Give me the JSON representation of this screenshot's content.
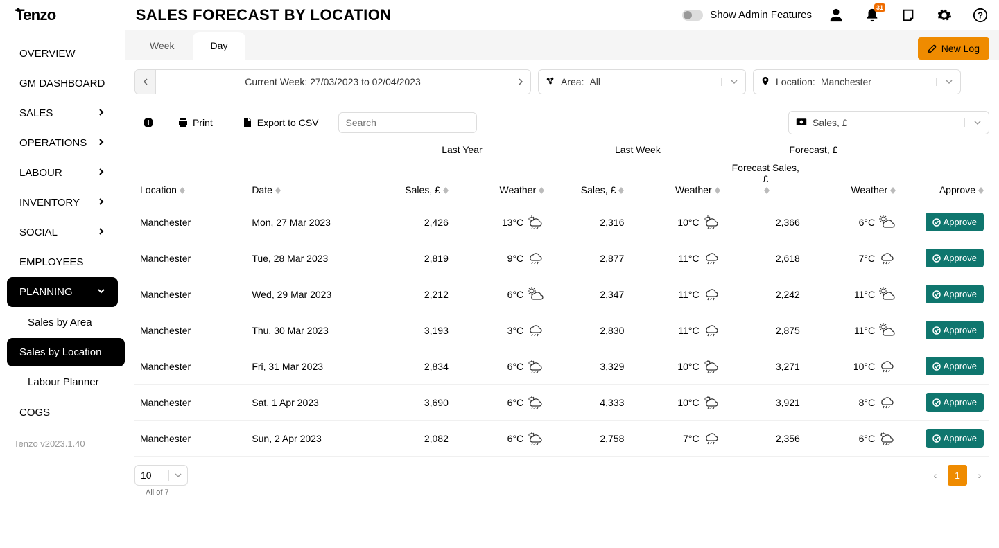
{
  "header": {
    "logo_text": "Tenzo",
    "page_title": "SALES FORECAST BY LOCATION",
    "admin_toggle_label": "Show Admin Features",
    "notification_count": "31",
    "new_log_label": "New Log"
  },
  "sidebar": {
    "items": [
      {
        "label": "OVERVIEW",
        "has_children": false
      },
      {
        "label": "GM DASHBOARD",
        "has_children": false
      },
      {
        "label": "SALES",
        "has_children": true
      },
      {
        "label": "OPERATIONS",
        "has_children": true
      },
      {
        "label": "LABOUR",
        "has_children": true
      },
      {
        "label": "INVENTORY",
        "has_children": true
      },
      {
        "label": "SOCIAL",
        "has_children": true
      },
      {
        "label": "EMPLOYEES",
        "has_children": false
      },
      {
        "label": "PLANNING",
        "has_children": true,
        "expanded": true,
        "active": true
      }
    ],
    "planning_subs": [
      {
        "label": "Sales by Area"
      },
      {
        "label": "Sales by Location",
        "active": true
      },
      {
        "label": "Labour Planner"
      }
    ],
    "cogs_label": "COGS",
    "version": "Tenzo v2023.1.40"
  },
  "tabs": {
    "week": "Week",
    "day": "Day"
  },
  "filters": {
    "date_label": "Current Week: 27/03/2023 to 02/04/2023",
    "area_label": "Area:",
    "area_value": "All",
    "location_label": "Location:",
    "location_value": "Manchester"
  },
  "toolbar": {
    "print_label": "Print",
    "export_label": "Export to CSV",
    "search_placeholder": "Search",
    "metric_value": "Sales, £"
  },
  "table": {
    "group_headers": {
      "last_year": "Last Year",
      "last_week": "Last Week",
      "forecast": "Forecast, £"
    },
    "columns": {
      "location": "Location",
      "date": "Date",
      "sales": "Sales, £",
      "weather": "Weather",
      "forecast_sales": "Forecast Sales, £",
      "approve": "Approve"
    },
    "approve_btn_label": "Approve",
    "rows": [
      {
        "location": "Manchester",
        "date": "Mon, 27 Mar 2023",
        "ly_sales": "2,426",
        "ly_temp": "13°C",
        "ly_wicon": "sleet",
        "lw_sales": "2,316",
        "lw_temp": "10°C",
        "lw_wicon": "sleet",
        "fc_sales": "2,366",
        "fc_temp": "6°C",
        "fc_wicon": "partly"
      },
      {
        "location": "Manchester",
        "date": "Tue, 28 Mar 2023",
        "ly_sales": "2,819",
        "ly_temp": "9°C",
        "ly_wicon": "rain",
        "lw_sales": "2,877",
        "lw_temp": "11°C",
        "lw_wicon": "rain",
        "fc_sales": "2,618",
        "fc_temp": "7°C",
        "fc_wicon": "rain"
      },
      {
        "location": "Manchester",
        "date": "Wed, 29 Mar 2023",
        "ly_sales": "2,212",
        "ly_temp": "6°C",
        "ly_wicon": "partly",
        "lw_sales": "2,347",
        "lw_temp": "11°C",
        "lw_wicon": "rain",
        "fc_sales": "2,242",
        "fc_temp": "11°C",
        "fc_wicon": "partly"
      },
      {
        "location": "Manchester",
        "date": "Thu, 30 Mar 2023",
        "ly_sales": "3,193",
        "ly_temp": "3°C",
        "ly_wicon": "rain",
        "lw_sales": "2,830",
        "lw_temp": "11°C",
        "lw_wicon": "rain",
        "fc_sales": "2,875",
        "fc_temp": "11°C",
        "fc_wicon": "partly"
      },
      {
        "location": "Manchester",
        "date": "Fri, 31 Mar 2023",
        "ly_sales": "2,834",
        "ly_temp": "6°C",
        "ly_wicon": "sleet",
        "lw_sales": "3,329",
        "lw_temp": "10°C",
        "lw_wicon": "sleet",
        "fc_sales": "3,271",
        "fc_temp": "10°C",
        "fc_wicon": "rain"
      },
      {
        "location": "Manchester",
        "date": "Sat, 1 Apr 2023",
        "ly_sales": "3,690",
        "ly_temp": "6°C",
        "ly_wicon": "sleet",
        "lw_sales": "4,333",
        "lw_temp": "10°C",
        "lw_wicon": "sleet",
        "fc_sales": "3,921",
        "fc_temp": "8°C",
        "fc_wicon": "rain"
      },
      {
        "location": "Manchester",
        "date": "Sun, 2 Apr 2023",
        "ly_sales": "2,082",
        "ly_temp": "6°C",
        "ly_wicon": "sleet",
        "lw_sales": "2,758",
        "lw_temp": "7°C",
        "lw_wicon": "rain",
        "fc_sales": "2,356",
        "fc_temp": "6°C",
        "fc_wicon": "sleet"
      }
    ]
  },
  "footer": {
    "page_size": "10",
    "all_of": "All of 7",
    "current_page": "1"
  }
}
